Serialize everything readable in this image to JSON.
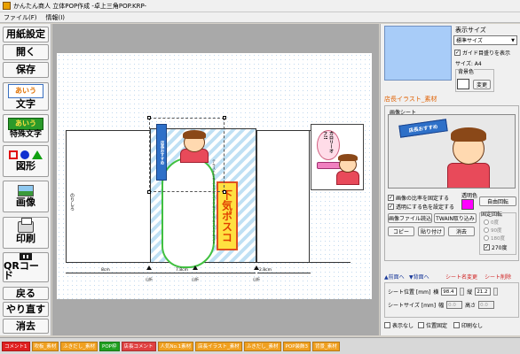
{
  "window": {
    "title": "かんたん商人 立体POP作成 -卓上三角POP.KRP-"
  },
  "menu": {
    "file": "ファイル(F)",
    "info": "情報(I)"
  },
  "sidebar": {
    "paper_setting": "用紙設定",
    "open": "開く",
    "save": "保存",
    "text_tile": "あいう",
    "text": "文字",
    "special_tile": "あいう",
    "special_text": "特殊文字",
    "shape": "図形",
    "image": "画像",
    "print": "印刷",
    "qr": "QRコード",
    "back": "戻る",
    "redo": "やり直す",
    "erase": "消去"
  },
  "canvas": {
    "banner_text": "店長おすすめ",
    "big_text": "下気ポスコ",
    "body_text": "テキストテキストテキストテキストテキストテキスト",
    "preview_bubble": "カロリーオフ!!",
    "dim_left": "8cm",
    "dim_mid": "7.8cm",
    "dim_right": "2.8cm",
    "tick_a": "山折",
    "tick_b": "山折",
    "tick_c": "山折",
    "side_label": "のりしろ"
  },
  "right_panel": {
    "display_size_label": "表示サイズ",
    "display_size_value": "標準サイズ",
    "guide_label": "ガイド目盛りを表示",
    "size_text": "サイズ: A4",
    "bg_color_label": "背景色",
    "change_button": "変更",
    "section_title": "店長イラスト_素材",
    "sheet_label": "画像シート",
    "sheet_ribbon": "店長おすすめ",
    "fix_ratio": "画像の比率を固定する",
    "transparent": "透明にする色を設定する",
    "transparent_color_label": "透明色",
    "free_rotate": "自由回転",
    "fixed_rotate": "固定回転",
    "rot_0": "0度",
    "rot_90": "90度",
    "rot_180": "180度",
    "rot_270": "270度",
    "load_image": "画像ファイル読込",
    "twain": "TWAIN取り込み",
    "copy": "コピー",
    "paste": "貼り付け",
    "erase": "消去",
    "front": "▲前面へ",
    "back": "▼背面へ",
    "rename": "シート名変更",
    "delete": "シート削除",
    "pos_label": "シート位置 [mm]",
    "horizontal": "横",
    "vertical": "縦",
    "pos_x": "98.4",
    "pos_y": "21.2",
    "size_label": "シートサイズ [mm]",
    "width": "幅",
    "height": "高さ",
    "w_val": "0.0",
    "h_val": "0.0",
    "hide": "表示なし",
    "lock_pos": "位置固定",
    "no_print": "印刷なし"
  },
  "tabs": [
    {
      "label": "コメント1",
      "color": "#e02020"
    },
    {
      "label": "吹板_素材",
      "color": "#f0a020"
    },
    {
      "label": "ふきだし_素材",
      "color": "#f0a020"
    },
    {
      "label": "POP枠",
      "color": "#20a020"
    },
    {
      "label": "店長コメント",
      "color": "#e04040"
    },
    {
      "label": "人気No.1素材",
      "color": "#f0a020"
    },
    {
      "label": "店長イラスト_素材",
      "color": "#f0a020"
    },
    {
      "label": "ふきだし_素材",
      "color": "#f0a020"
    },
    {
      "label": "POP装飾3",
      "color": "#f0a020"
    },
    {
      "label": "背景_素材",
      "color": "#f0a020"
    }
  ]
}
